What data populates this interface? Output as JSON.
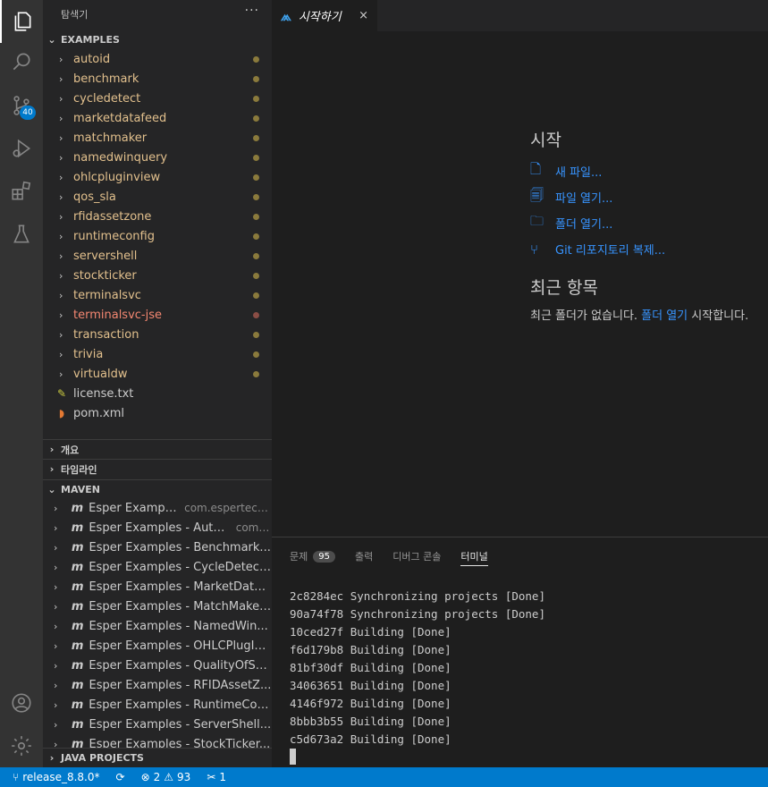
{
  "explorer": {
    "title": "탐색기",
    "more": "···",
    "root": "EXAMPLES",
    "folders": [
      {
        "label": "autoid",
        "state": "modified"
      },
      {
        "label": "benchmark",
        "state": "modified"
      },
      {
        "label": "cycledetect",
        "state": "modified"
      },
      {
        "label": "marketdatafeed",
        "state": "modified"
      },
      {
        "label": "matchmaker",
        "state": "modified"
      },
      {
        "label": "namedwinquery",
        "state": "modified"
      },
      {
        "label": "ohlcpluginview",
        "state": "modified"
      },
      {
        "label": "qos_sla",
        "state": "modified"
      },
      {
        "label": "rfidassetzone",
        "state": "modified"
      },
      {
        "label": "runtimeconfig",
        "state": "modified"
      },
      {
        "label": "servershell",
        "state": "modified"
      },
      {
        "label": "stockticker",
        "state": "modified"
      },
      {
        "label": "terminalsvc",
        "state": "modified"
      },
      {
        "label": "terminalsvc-jse",
        "state": "error"
      },
      {
        "label": "transaction",
        "state": "modified"
      },
      {
        "label": "trivia",
        "state": "modified"
      },
      {
        "label": "virtualdw",
        "state": "modified"
      }
    ],
    "files": [
      {
        "label": "license.txt",
        "icon": "license-icon"
      },
      {
        "label": "pom.xml",
        "icon": "rss-icon"
      }
    ]
  },
  "sections": {
    "outline": "개요",
    "timeline": "타임라인",
    "maven": "MAVEN",
    "java_projects": "JAVA PROJECTS"
  },
  "maven": {
    "items": [
      {
        "name": "Esper Examples",
        "desc": "com.espertech..."
      },
      {
        "name": "Esper Examples - AutoID",
        "desc": "com...."
      },
      {
        "name": "Esper Examples - Benchmark...",
        "desc": ""
      },
      {
        "name": "Esper Examples - CycleDetect...",
        "desc": ""
      },
      {
        "name": "Esper Examples - MarketData...",
        "desc": ""
      },
      {
        "name": "Esper Examples - MatchMaker...",
        "desc": ""
      },
      {
        "name": "Esper Examples - NamedWin...",
        "desc": ""
      },
      {
        "name": "Esper Examples - OHLCPlugIn...",
        "desc": ""
      },
      {
        "name": "Esper Examples - QualityOfSe...",
        "desc": ""
      },
      {
        "name": "Esper Examples - RFIDAssetZ...",
        "desc": ""
      },
      {
        "name": "Esper Examples - RuntimeCon...",
        "desc": ""
      },
      {
        "name": "Esper Examples - ServerShell...",
        "desc": ""
      },
      {
        "name": "Esper Examples - StockTicker...",
        "desc": ""
      }
    ],
    "m_glyph": "m"
  },
  "activity": {
    "scm_badge": "40"
  },
  "editor": {
    "tab_label": "시작하기",
    "tab_close": "×"
  },
  "welcome": {
    "start_heading": "시작",
    "links": [
      {
        "label": "새 파일...",
        "icon": "new-file-icon"
      },
      {
        "label": "파일 열기...",
        "icon": "open-file-icon"
      },
      {
        "label": "폴더 열기...",
        "icon": "folder-icon"
      },
      {
        "label": "Git 리포지토리 복제...",
        "icon": "git-branch-icon"
      }
    ],
    "recent_heading": "최근 항목",
    "recent_prefix": "최근 폴더가 없습니다. ",
    "recent_link": "폴더 열기",
    "recent_suffix": " 시작합니다."
  },
  "panel": {
    "tabs": [
      {
        "label": "문제",
        "badge": "95"
      },
      {
        "label": "출력",
        "badge": ""
      },
      {
        "label": "디버그 콘솔",
        "badge": ""
      },
      {
        "label": "터미널",
        "badge": ""
      }
    ],
    "active_tab": "터미널",
    "terminal_lines": [
      "2c8284ec Synchronizing projects [Done]",
      "90a74f78 Synchronizing projects [Done]",
      "10ced27f Building [Done]",
      "f6d179b8 Building [Done]",
      "81bf30df Building [Done]",
      "34063651 Building [Done]",
      "4146f972 Building [Done]",
      "8bbb3b55 Building [Done]",
      "c5d673a2 Building [Done]"
    ]
  },
  "status": {
    "branch": "release_8.8.0*",
    "errors": "2",
    "warnings": "93",
    "tools": "1"
  },
  "colors": {
    "accent": "#007acc",
    "modified": "#e2c08d",
    "error": "#f48771",
    "link": "#3794ff"
  }
}
